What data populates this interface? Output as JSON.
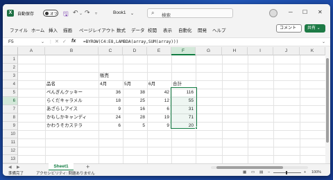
{
  "app": {
    "logo": "X",
    "autosave_label": "自動保存",
    "autosave_state": "オフ",
    "book_name": "Book1",
    "search_placeholder": "検索"
  },
  "icons": {
    "save": "save-icon",
    "undo": "undo-icon",
    "redo": "redo-icon"
  },
  "window_controls": {
    "minimize": "─",
    "maximize": "☐",
    "close": "✕"
  },
  "menu": [
    "ファイル",
    "ホーム",
    "挿入",
    "描画",
    "ページレイアウト",
    "数式",
    "データ",
    "校閲",
    "表示",
    "自動化",
    "開発",
    "ヘルプ"
  ],
  "buttons": {
    "comment": "コメント",
    "share": "共有"
  },
  "formula_bar": {
    "name_box": "F5",
    "fx": "fx",
    "formula": "=BYROW(C4:E8,LAMBDA(array,SUM(array)))"
  },
  "columns": [
    "A",
    "B",
    "C",
    "D",
    "E",
    "F",
    "G",
    "H",
    "I",
    "J",
    "K"
  ],
  "rows": [
    "1",
    "2",
    "3",
    "4",
    "5",
    "6",
    "7",
    "8",
    "9",
    "10",
    "11",
    "12",
    "13"
  ],
  "table": {
    "group_header": "販売",
    "headers": [
      "品名",
      "4月",
      "5月",
      "6月",
      "合計"
    ],
    "rows": [
      [
        "ぺんぎんクッキー",
        "36",
        "38",
        "42",
        "116"
      ],
      [
        "らくだキャラメル",
        "18",
        "25",
        "12",
        "55"
      ],
      [
        "あざらしアイス",
        "9",
        "16",
        "6",
        "31"
      ],
      [
        "かもしかキャンディ",
        "24",
        "28",
        "19",
        "71"
      ],
      [
        "かわうそカステラ",
        "6",
        "5",
        "9",
        "20"
      ]
    ]
  },
  "sheet_tab": "Sheet1",
  "status": {
    "ready": "準備完了",
    "accessibility": "アクセシビリティ: 問題ありません",
    "zoom": "100%"
  },
  "colors": {
    "accent": "#107c41",
    "share": "#1d7a45"
  }
}
